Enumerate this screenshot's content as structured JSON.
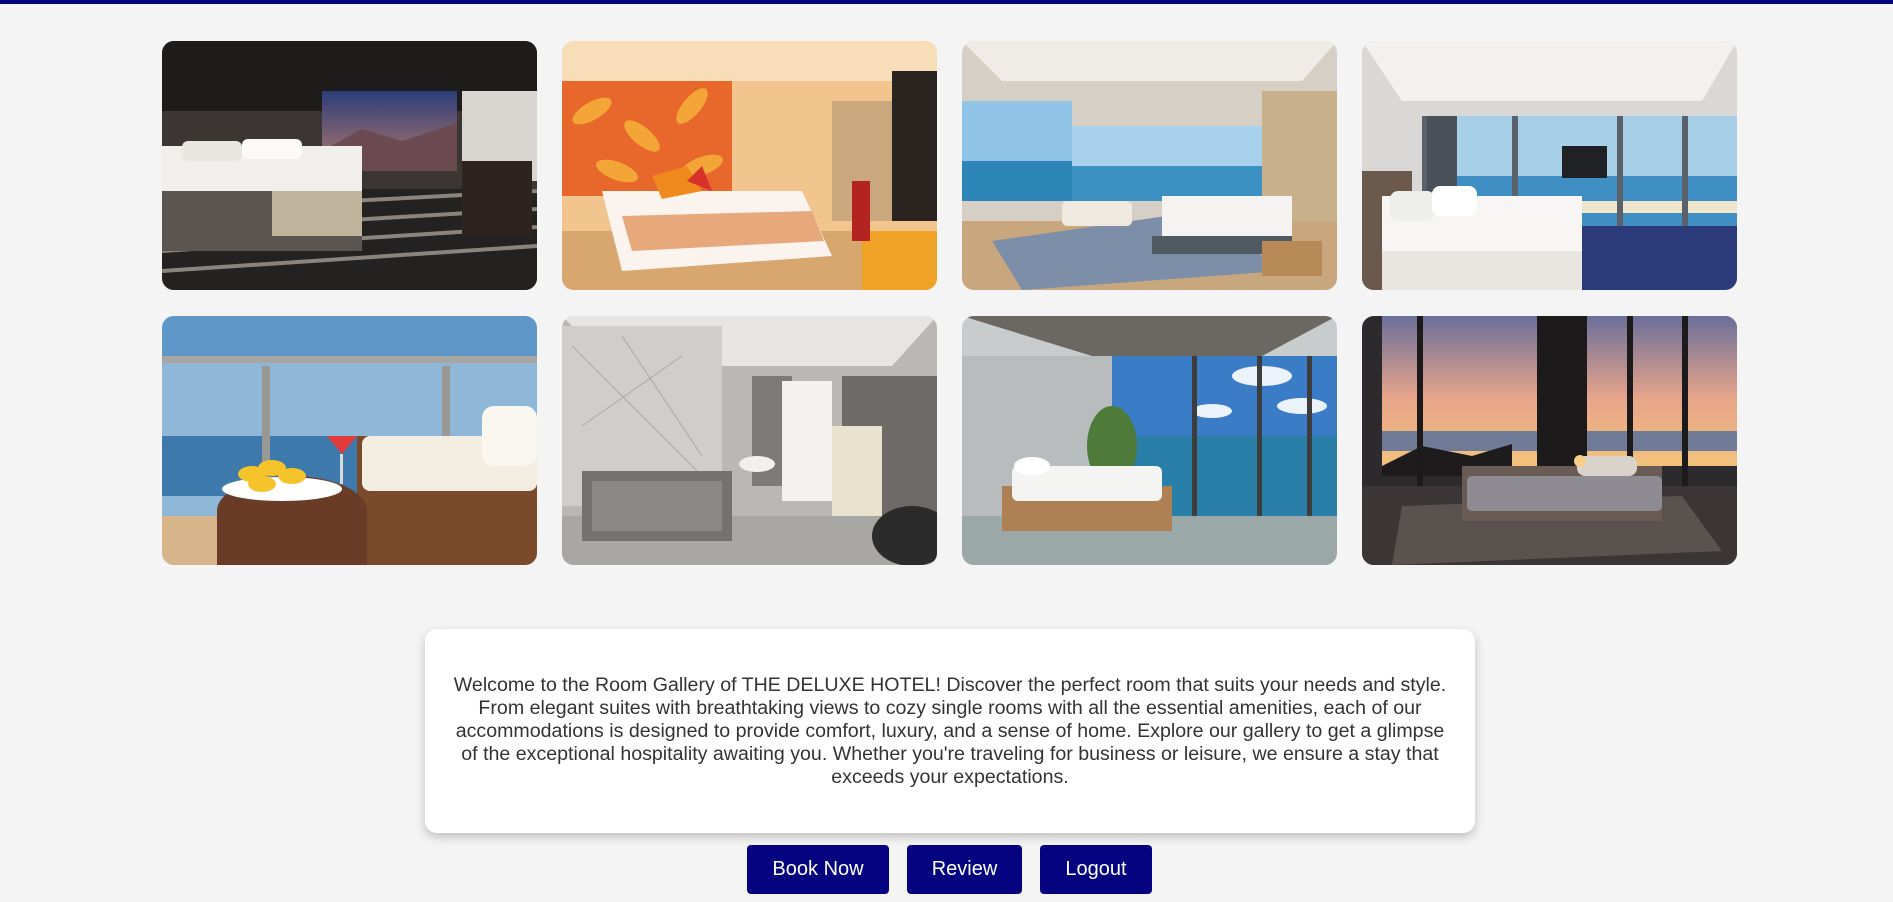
{
  "gallery": {
    "photos": [
      {
        "alt": "Hotel room with two beds and mountain view",
        "icon": "room-photo"
      },
      {
        "alt": "Bedroom with orange patterned wall",
        "icon": "room-photo"
      },
      {
        "alt": "Suite with ocean view and lounge",
        "icon": "room-photo"
      },
      {
        "alt": "Bedroom with panoramic sea windows",
        "icon": "room-photo"
      },
      {
        "alt": "Balcony with fruit platter and cocktail",
        "icon": "room-photo"
      },
      {
        "alt": "Marble bathroom with tub",
        "icon": "room-photo"
      },
      {
        "alt": "Glass-walled bedroom facing the sea",
        "icon": "room-photo"
      },
      {
        "alt": "Bedroom at sunset with palm trees",
        "icon": "room-photo"
      }
    ]
  },
  "intro": {
    "text": "Welcome to the Room Gallery of THE DELUXE HOTEL! Discover the perfect room that suits your needs and style. From elegant suites with breathtaking views to cozy single rooms with all the essential amenities, each of our accommodations is designed to provide comfort, luxury, and a sense of home. Explore our gallery to get a glimpse of the exceptional hospitality awaiting you. Whether you're traveling for business or leisure, we ensure a stay that exceeds your expectations."
  },
  "actions": {
    "book_label": "Book Now",
    "review_label": "Review",
    "logout_label": "Logout"
  },
  "colors": {
    "accent": "#050380",
    "background": "#f4f4f4"
  }
}
